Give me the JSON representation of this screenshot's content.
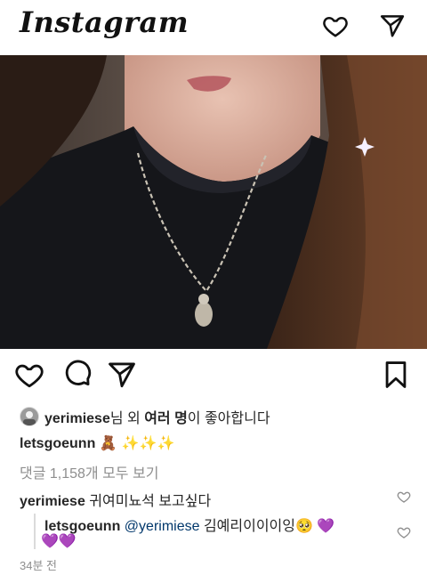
{
  "header": {
    "logo": "Instagram"
  },
  "post": {
    "likes": {
      "username": "yerimiese",
      "text_after_name": "님 외 ",
      "bold_count": "여러 명",
      "text_end": "이 좋아합니다"
    },
    "caption": {
      "username": "letsgoeunn",
      "emojis": "🧸 ✨✨✨"
    },
    "view_comments": "댓글 1,158개 모두 보기",
    "comments": [
      {
        "username": "yerimiese",
        "text": "귀여미뇨석 보고싶다"
      },
      {
        "username": "letsgoeunn",
        "mention": "@yerimiese",
        "text": "김예리이이이잉🥺",
        "emoji_tail": "💜",
        "emoji_line2": "💜💜"
      }
    ],
    "timestamp": "34분 전"
  },
  "colors": {
    "link": "#00376b",
    "secondary_text": "#8e8e8e",
    "emoji_purple": "#9b4dea"
  },
  "icons": {
    "header": [
      "heart-icon",
      "paper-plane-icon"
    ],
    "actions": [
      "heart-icon",
      "comment-icon",
      "share-icon",
      "bookmark-icon"
    ]
  }
}
